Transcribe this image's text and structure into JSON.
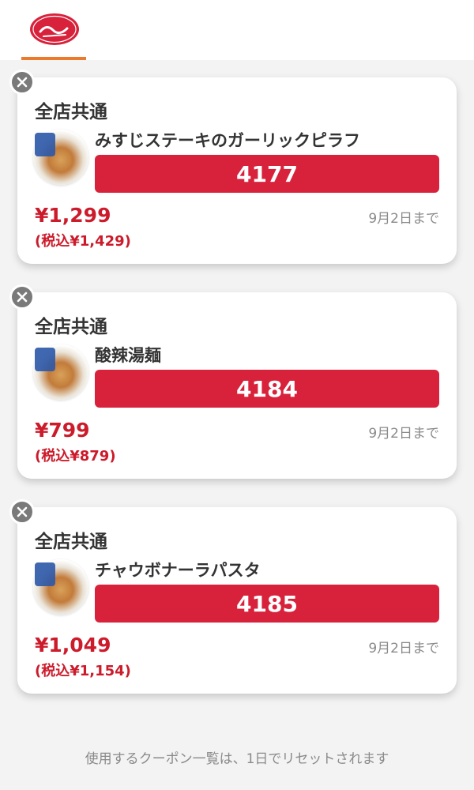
{
  "header": {
    "logo_name": "Jonathan's COFFEE & RESTAURANT logo"
  },
  "coupons": [
    {
      "scope": "全店共通",
      "name": "みすじステーキのガーリックピラフ",
      "code": "4177",
      "price": "¥1,299",
      "tax_price": "(税込¥1,429)",
      "expiry": "9月2日まで"
    },
    {
      "scope": "全店共通",
      "name": "酸辣湯麺",
      "code": "4184",
      "price": "¥799",
      "tax_price": "(税込¥879)",
      "expiry": "9月2日まで"
    },
    {
      "scope": "全店共通",
      "name": "チャウボナーラパスタ",
      "code": "4185",
      "price": "¥1,049",
      "tax_price": "(税込¥1,154)",
      "expiry": "9月2日まで"
    }
  ],
  "footer_note": "使用するクーポン一覧は、1日でリセットされます",
  "colors": {
    "accent": "#ec7a2c",
    "code_bg": "#d8213b",
    "price": "#cc1b2b"
  }
}
